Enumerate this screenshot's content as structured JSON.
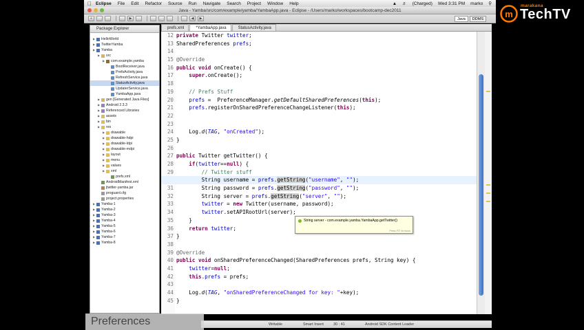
{
  "menubar": {
    "app": "Eclipse",
    "items": [
      "File",
      "Edit",
      "Refactor",
      "Source",
      "Run",
      "Navigate",
      "Search",
      "Project",
      "Window",
      "Help"
    ],
    "battery": "(Charged)",
    "clock": "Wed 3:31 PM",
    "user": "marko"
  },
  "window": {
    "title": "Java - Yamba/src/com/example/yamba/YambaApp.java - Eclipse - /Users/marko/workspaces/bootcamp-dec2011"
  },
  "perspectives": [
    "Java",
    "DDMS"
  ],
  "explorer": {
    "title": "Package Explorer",
    "items": [
      {
        "label": "HelloWorld",
        "level": 0,
        "icon": "project-icon"
      },
      {
        "label": "TwitterYamba",
        "level": 0,
        "icon": "project-icon"
      },
      {
        "label": "Yamba",
        "level": 0,
        "icon": "project-icon"
      },
      {
        "label": "src",
        "level": 1,
        "icon": "source-folder-icon"
      },
      {
        "label": "com.example.yamba",
        "level": 2,
        "icon": "package-icon"
      },
      {
        "label": "BootReceiver.java",
        "level": 3,
        "icon": "java-file-icon"
      },
      {
        "label": "PrefsActivity.java",
        "level": 3,
        "icon": "java-file-icon"
      },
      {
        "label": "RefreshService.java",
        "level": 3,
        "icon": "java-file-icon"
      },
      {
        "label": "StatusActivity.java",
        "level": 3,
        "icon": "java-file-icon",
        "selected": true
      },
      {
        "label": "UpdaterService.java",
        "level": 3,
        "icon": "java-file-icon"
      },
      {
        "label": "YambaApp.java",
        "level": 3,
        "icon": "java-file-icon"
      },
      {
        "label": "gen [Generated Java Files]",
        "level": 1,
        "icon": "source-folder-icon"
      },
      {
        "label": "Android 2.3.3",
        "level": 1,
        "icon": "library-icon"
      },
      {
        "label": "Referenced Libraries",
        "level": 1,
        "icon": "library-icon"
      },
      {
        "label": "assets",
        "level": 1,
        "icon": "folder-icon"
      },
      {
        "label": "bin",
        "level": 1,
        "icon": "folder-icon"
      },
      {
        "label": "res",
        "level": 1,
        "icon": "folder-icon"
      },
      {
        "label": "drawable",
        "level": 2,
        "icon": "folder-icon"
      },
      {
        "label": "drawable-hdpi",
        "level": 2,
        "icon": "folder-icon"
      },
      {
        "label": "drawable-ldpi",
        "level": 2,
        "icon": "folder-icon"
      },
      {
        "label": "drawable-mdpi",
        "level": 2,
        "icon": "folder-icon"
      },
      {
        "label": "layout",
        "level": 2,
        "icon": "folder-icon"
      },
      {
        "label": "menu",
        "level": 2,
        "icon": "folder-icon"
      },
      {
        "label": "values",
        "level": 2,
        "icon": "folder-icon"
      },
      {
        "label": "xml",
        "level": 2,
        "icon": "folder-icon"
      },
      {
        "label": "prefs.xml",
        "level": 3,
        "icon": "xml-file-icon"
      },
      {
        "label": "AndroidManifest.xml",
        "level": 1,
        "icon": "xml-file-icon"
      },
      {
        "label": "jtwitter-yamba.jar",
        "level": 1,
        "icon": "jar-icon"
      },
      {
        "label": "proguard.cfg",
        "level": 1,
        "icon": "file-icon"
      },
      {
        "label": "project.properties",
        "level": 1,
        "icon": "file-icon"
      },
      {
        "label": "Yamba-1",
        "level": 0,
        "icon": "project-icon"
      },
      {
        "label": "Yamba-2",
        "level": 0,
        "icon": "project-icon"
      },
      {
        "label": "Yamba-3",
        "level": 0,
        "icon": "project-icon"
      },
      {
        "label": "Yamba-4",
        "level": 0,
        "icon": "project-icon"
      },
      {
        "label": "Yamba-5",
        "level": 0,
        "icon": "project-icon"
      },
      {
        "label": "Yamba-6",
        "level": 0,
        "icon": "project-icon"
      },
      {
        "label": "Yamba-7",
        "level": 0,
        "icon": "project-icon"
      },
      {
        "label": "Yamba-8",
        "level": 0,
        "icon": "project-icon"
      }
    ]
  },
  "editor": {
    "tabs": [
      {
        "label": "prefs.xml",
        "active": false
      },
      {
        "label": "*YambaApp.java",
        "active": true
      },
      {
        "label": "StatusActivity.java",
        "active": false
      }
    ],
    "first_line_number": 12,
    "current_line": 30,
    "lines": [
      [
        [
          "kw",
          "private "
        ],
        [
          "",
          "Twitter "
        ],
        [
          "fld",
          "twitter"
        ],
        [
          "",
          ";"
        ]
      ],
      [
        [
          "",
          "SharedPreferences "
        ],
        [
          "fld",
          "prefs"
        ],
        [
          "",
          ";"
        ]
      ],
      [],
      [
        [
          "ann",
          "@Override"
        ]
      ],
      [
        [
          "kw",
          "public void "
        ],
        [
          "",
          "onCreate() {"
        ]
      ],
      [
        [
          "",
          "    "
        ],
        [
          "kw",
          "super"
        ],
        [
          "",
          ".onCreate();"
        ]
      ],
      [],
      [
        [
          "",
          "    "
        ],
        [
          "cmt",
          "// Prefs Stuff"
        ]
      ],
      [
        [
          "",
          "    "
        ],
        [
          "fld",
          "prefs"
        ],
        [
          "",
          " =  PreferenceManager."
        ],
        [
          "ital",
          "getDefaultSharedPreferences"
        ],
        [
          "",
          "("
        ],
        [
          "kw",
          "this"
        ],
        [
          "",
          ");"
        ]
      ],
      [
        [
          "",
          "    "
        ],
        [
          "fld",
          "prefs"
        ],
        [
          "",
          ".registerOnSharedPreferenceChangeListener("
        ],
        [
          "kw",
          "this"
        ],
        [
          "",
          ");"
        ]
      ],
      [],
      [],
      [
        [
          "",
          "    Log."
        ],
        [
          "ital",
          "d"
        ],
        [
          "",
          "("
        ],
        [
          "fld ital",
          "TAG"
        ],
        [
          "",
          ", "
        ],
        [
          "str",
          "\"onCreated\""
        ],
        [
          "",
          ");"
        ]
      ],
      [
        [
          "",
          "}"
        ]
      ],
      [],
      [
        [
          "kw",
          "public "
        ],
        [
          "",
          "Twitter getTwitter() {"
        ]
      ],
      [
        [
          "",
          "    "
        ],
        [
          "kw",
          "if"
        ],
        [
          "",
          "("
        ],
        [
          "fld",
          "twitter"
        ],
        [
          "",
          "=="
        ],
        [
          "kw",
          "null"
        ],
        [
          "",
          ") {"
        ]
      ],
      [
        [
          "",
          "        "
        ],
        [
          "cmt",
          "// Twitter stuff"
        ]
      ],
      [
        [
          "",
          "        String username = "
        ],
        [
          "fld",
          "prefs"
        ],
        [
          "",
          "."
        ],
        [
          "hl",
          "getString"
        ],
        [
          "",
          "("
        ],
        [
          "str",
          "\"username\""
        ],
        [
          "",
          ", "
        ],
        [
          "str",
          "\"\""
        ],
        [
          "",
          ");"
        ]
      ],
      [
        [
          "",
          "        String password = "
        ],
        [
          "fld",
          "prefs"
        ],
        [
          "",
          "."
        ],
        [
          "hl",
          "getString"
        ],
        [
          "",
          "("
        ],
        [
          "str",
          "\"password\""
        ],
        [
          "",
          ", "
        ],
        [
          "str",
          "\"\""
        ],
        [
          "",
          ");"
        ]
      ],
      [
        [
          "",
          "        String server = "
        ],
        [
          "fld",
          "prefs"
        ],
        [
          "",
          "."
        ],
        [
          "hl",
          "getString"
        ],
        [
          "",
          "("
        ],
        [
          "str",
          "\"server\""
        ],
        [
          "",
          ", "
        ],
        [
          "str",
          "\"\""
        ],
        [
          "",
          ");"
        ]
      ],
      [
        [
          "",
          "        "
        ],
        [
          "fld",
          "twitter"
        ],
        [
          "",
          " = "
        ],
        [
          "kw",
          "new "
        ],
        [
          "",
          "Twitter(username, password);"
        ]
      ],
      [
        [
          "",
          "        "
        ],
        [
          "fld",
          "twitter"
        ],
        [
          "",
          ".setAPIRootUrl(server);"
        ]
      ],
      [
        [
          "",
          "    }"
        ]
      ],
      [
        [
          "",
          "    "
        ],
        [
          "kw",
          "return "
        ],
        [
          "fld",
          "twitter"
        ],
        [
          "",
          ";"
        ]
      ],
      [
        [
          "",
          "}"
        ]
      ],
      [],
      [
        [
          "ann",
          "@Override"
        ]
      ],
      [
        [
          "kw",
          "public void "
        ],
        [
          "",
          "onSharedPreferenceChanged(SharedPreferences prefs, String key) {"
        ]
      ],
      [
        [
          "",
          "    "
        ],
        [
          "fld",
          "twitter"
        ],
        [
          "",
          "="
        ],
        [
          "kw",
          "null"
        ],
        [
          "",
          ";"
        ]
      ],
      [
        [
          "",
          "    "
        ],
        [
          "kw",
          "this"
        ],
        [
          "",
          "."
        ],
        [
          "fld",
          "prefs"
        ],
        [
          "",
          " = prefs;"
        ]
      ],
      [],
      [
        [
          "",
          "    Log."
        ],
        [
          "ital",
          "d"
        ],
        [
          "",
          "("
        ],
        [
          "fld ital",
          "TAG"
        ],
        [
          "",
          ", "
        ],
        [
          "str",
          "\"onSharedPreferenceChanged for key: \""
        ],
        [
          "",
          "+key);"
        ]
      ],
      [
        [
          "",
          "}"
        ]
      ]
    ]
  },
  "tooltip": {
    "text": "String server - com.example.yamba.YambaApp.getTwitter()",
    "footer": "Press 'F2' for focus"
  },
  "statusbar": {
    "writable": "Writable",
    "insert_mode": "Smart Insert",
    "position": "30 : 41",
    "task": "Android SDK Content Loader"
  },
  "caption": "Preferences",
  "brand": {
    "small": "marakana",
    "big": "TechTV"
  }
}
